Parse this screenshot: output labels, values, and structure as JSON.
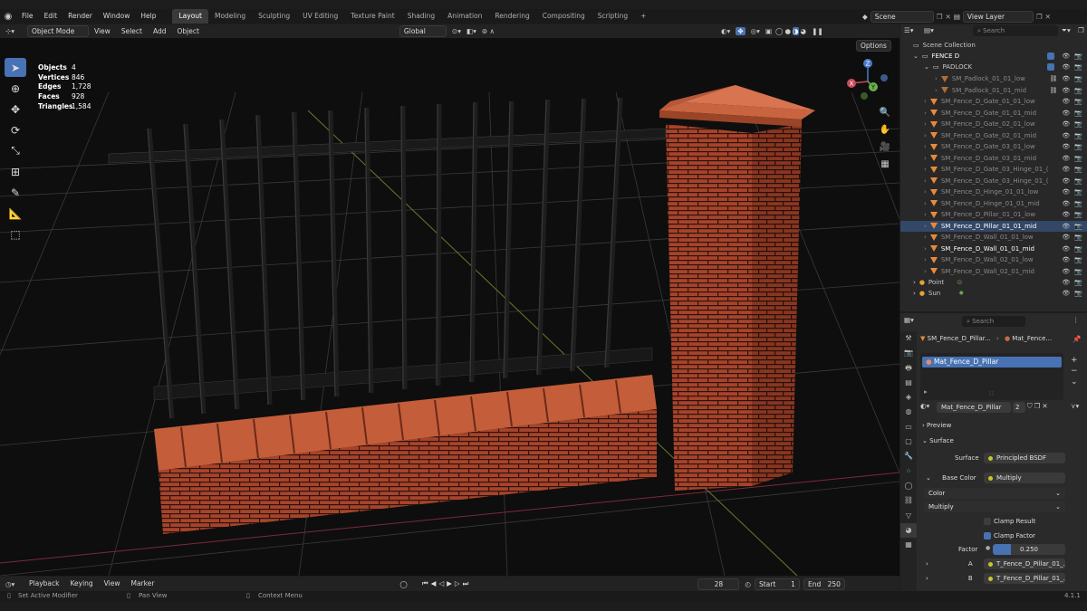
{
  "topbar": {
    "menus": [
      "File",
      "Edit",
      "Render",
      "Window",
      "Help"
    ],
    "workspaces": [
      "Layout",
      "Modeling",
      "Sculpting",
      "UV Editing",
      "Texture Paint",
      "Shading",
      "Animation",
      "Rendering",
      "Compositing",
      "Scripting"
    ],
    "active_workspace": "Layout",
    "add_workspace": "+",
    "scene_label": "Scene",
    "view_layer_label": "View Layer"
  },
  "viewport_header": {
    "mode": "Object Mode",
    "menus": [
      "View",
      "Select",
      "Add",
      "Object"
    ],
    "transform_orientation": "Global",
    "options_label": "Options"
  },
  "stats": [
    {
      "key": "Objects",
      "value": "4"
    },
    {
      "key": "Vertices",
      "value": "846"
    },
    {
      "key": "Edges",
      "value": "1,728"
    },
    {
      "key": "Faces",
      "value": "928"
    },
    {
      "key": "Triangles",
      "value": "1,584"
    }
  ],
  "gizmo": {
    "x": "X",
    "y": "Y",
    "z": "Z"
  },
  "timeline": {
    "menus": [
      "Playback",
      "Keying",
      "View",
      "Marker"
    ],
    "current_frame": "28",
    "start_label": "Start",
    "start": "1",
    "end_label": "End",
    "end": "250"
  },
  "statusbar": {
    "left": "Set Active Modifier",
    "middle": "Pan View",
    "right": "Context Menu",
    "version": "4.1.1"
  },
  "outliner": {
    "search_placeholder": "Search",
    "root": "Scene Collection",
    "collection": "FENCE D",
    "subcollection": "PADLOCK",
    "padlock_items": [
      "SM_Padlock_01_01_low",
      "SM_Padlock_01_01_mid"
    ],
    "items": [
      "SM_Fence_D_Gate_01_01_low",
      "SM_Fence_D_Gate_01_01_mid",
      "SM_Fence_D_Gate_02_01_low",
      "SM_Fence_D_Gate_02_01_mid",
      "SM_Fence_D_Gate_03_01_low",
      "SM_Fence_D_Gate_03_01_mid",
      "SM_Fence_D_Gate_03_Hinge_01_(",
      "SM_Fence_D_Gate_03_Hinge_01_(",
      "SM_Fence_D_Hinge_01_01_low",
      "SM_Fence_D_Hinge_01_01_mid",
      "SM_Fence_D_Pillar_01_01_low",
      "SM_Fence_D_Pillar_01_01_mid",
      "SM_Fence_D_Wall_01_01_low",
      "SM_Fence_D_Wall_01_01_mid",
      "SM_Fence_D_Wall_02_01_low",
      "SM_Fence_D_Wall_02_01_mid"
    ],
    "point": "Point",
    "sun": "Sun"
  },
  "properties": {
    "search_placeholder": "Search",
    "breadcrumb_object": "SM_Fence_D_Pillar...",
    "breadcrumb_material": "Mat_Fence...",
    "slot_material": "Mat_Fence_D_Pillar",
    "material_name": "Mat_Fence_D_Pillar",
    "user_count": "2",
    "preview_label": "Preview",
    "surface_section": "Surface",
    "surface_label": "Surface",
    "surface_value": "Principled BSDF",
    "base_color_label": "Base Color",
    "base_color_value": "Multiply",
    "color_dropdown": "Color",
    "blend_dropdown": "Multiply",
    "clamp_result": "Clamp Result",
    "clamp_factor": "Clamp Factor",
    "factor_label": "Factor",
    "factor_value": "0.250",
    "factor_fraction": 0.25,
    "a_label": "A",
    "a_value": "T_Fence_D_Pillar_01_...",
    "b_label": "B",
    "b_value": "T_Fence_D_Pillar_01_..."
  },
  "colors": {
    "accent": "#4772b3",
    "brick": "#b04a2a",
    "mesh_orange": "#e78a3c"
  }
}
